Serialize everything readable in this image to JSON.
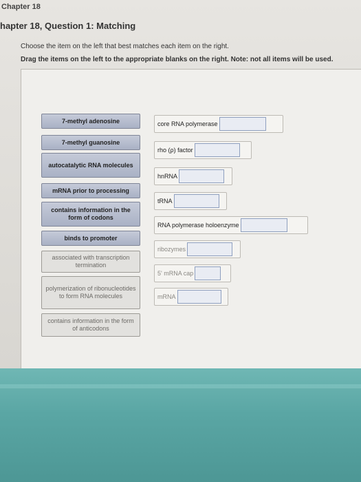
{
  "header": {
    "chapter": "Chapter 18",
    "question_title": "hapter 18, Question 1: Matching"
  },
  "instructions": {
    "line1": "Choose the item on the left that best matches each item on the right.",
    "line2": "Drag the items on the left to the appropriate blanks on the right. Note: not all items will be used."
  },
  "drag_items": [
    "7-methyl adenosine",
    "7-methyl guanosine",
    "autocatalytic RNA molecules",
    "mRNA prior to processing",
    "contains information in the form of codons",
    "binds to promoter",
    "associated with transcription termination",
    "polymerization of ribonucleotides to form RNA molecules",
    "contains information in the form of anticodons"
  ],
  "targets": [
    "core RNA polymerase",
    "rho (ρ) factor",
    "hnRNA",
    "tRNA",
    "RNA polymerase holoenzyme",
    "ribozymes",
    "5' mRNA cap",
    "mRNA"
  ],
  "colors": {
    "drag_item_bg": "#b4bbcd",
    "blank_border": "#8e9fbf",
    "bezel": "#5aa6a4"
  }
}
